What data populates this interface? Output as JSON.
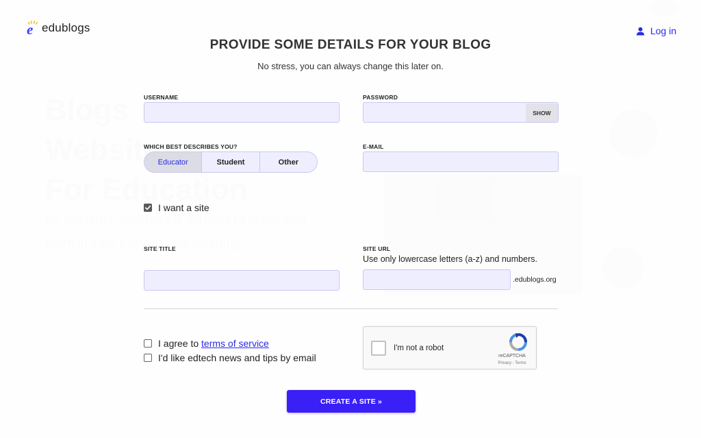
{
  "app": {
    "logo_text": "edublogs",
    "login_label": "Log in"
  },
  "background": {
    "hero_lines": [
      "Blogs",
      "Websites",
      "For Education"
    ],
    "sub_text": "for students, teachers & schools to share and learn in safe easy-to-use teaching"
  },
  "form": {
    "title": "PROVIDE SOME DETAILS FOR YOUR BLOG",
    "subtitle": "No stress, you can always change this later on.",
    "username": {
      "label": "USERNAME",
      "value": ""
    },
    "password": {
      "label": "PASSWORD",
      "value": "",
      "show_label": "SHOW"
    },
    "describes": {
      "label": "WHICH BEST DESCRIBES YOU?",
      "options": [
        "Educator",
        "Student",
        "Other"
      ],
      "selected": "Educator"
    },
    "email": {
      "label": "E-MAIL",
      "value": ""
    },
    "want_site": {
      "label": "I want a site",
      "checked": true
    },
    "site_title": {
      "label": "SITE TITLE",
      "value": ""
    },
    "site_url": {
      "label": "SITE URL",
      "hint": "Use only lowercase letters (a-z) and numbers.",
      "value": "",
      "suffix": ".edublogs.org"
    },
    "agree_terms": {
      "prefix": "I agree to ",
      "link": "terms of service",
      "checked": false
    },
    "newsletter": {
      "label": "I'd like edtech news and tips by email",
      "checked": false
    },
    "captcha": {
      "label": "I'm not a robot",
      "brand": "reCAPTCHA",
      "terms": "Privacy - Terms"
    },
    "submit_label": "CREATE A SITE »"
  },
  "colors": {
    "accent": "#3a1ff7",
    "link": "#2a2ae8",
    "input_bg": "#eeeeff"
  }
}
